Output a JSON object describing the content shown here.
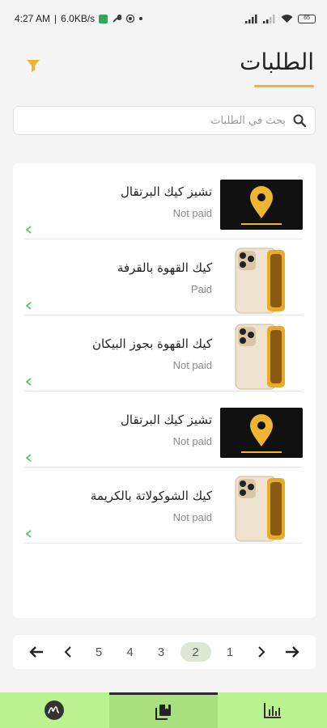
{
  "status_bar": {
    "time": "4:27 AM",
    "speed": "6.0KB/s",
    "battery": "65"
  },
  "header": {
    "title": "الطلبات",
    "accent_color": "#f0b530"
  },
  "search": {
    "placeholder": "بحث في الطلبات",
    "value": ""
  },
  "orders": [
    {
      "name": "تشيز كيك البرتقال",
      "status": "Not paid",
      "thumb": "pin"
    },
    {
      "name": "كيك القهوة بالقرفة",
      "status": "Paid",
      "thumb": "phone"
    },
    {
      "name": "كيك القهوة بجوز البيكان",
      "status": "Not paid",
      "thumb": "phone"
    },
    {
      "name": "تشيز كيك البرتقال",
      "status": "Not paid",
      "thumb": "pin"
    },
    {
      "name": "كيك الشوكولاتة بالكريمة",
      "status": "Not paid",
      "thumb": "phone"
    }
  ],
  "pagination": {
    "pages": [
      "5",
      "4",
      "3",
      "2",
      "1"
    ],
    "active_page": "2"
  },
  "bottom_nav": {
    "active_index": 1,
    "items": [
      "logo-icon",
      "orders-icon",
      "stats-icon"
    ],
    "bar_color": "#b9f28f"
  }
}
